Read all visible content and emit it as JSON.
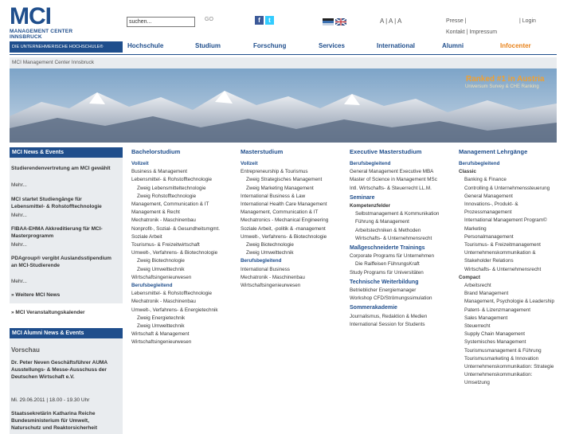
{
  "logo": {
    "mci": "MCI",
    "line1": "MANAGEMENT CENTER",
    "line2": "INNSBRUCK"
  },
  "tagline": "DIE UNTERNEHMERISCHE HOCHSCHULE®",
  "search": {
    "value": "suchen...",
    "go": "GO"
  },
  "font_size": "A | A | A",
  "top_links": {
    "presse": "Presse |",
    "login": "| Login",
    "kontakt": "Kontakt | Impressum"
  },
  "nav": [
    "Hochschule",
    "Studium",
    "Forschung",
    "Services",
    "International",
    "Alumni",
    "Infocenter"
  ],
  "breadcrumb": "MCI Management Center Innsbruck",
  "banner": {
    "ranked": "Ranked #1 in Austria",
    "survey": "Universum Survey & CHE Ranking"
  },
  "news": {
    "header": "MCI News & Events",
    "items": [
      {
        "title": "Studierendenvertretung am MCI gewählt",
        "more": "Mehr..."
      },
      {
        "title": "MCI startet Studiengänge für Lebensmittel- & Rohstofftechnologie",
        "more": "Mehr..."
      },
      {
        "title": "FIBAA-EHMA Akkreditierung für MCI-Masterprogramm",
        "more": "Mehr..."
      },
      {
        "title": "PDAgroup® vergibt Auslandsstipendium an MCI-Studierende",
        "more": "Mehr..."
      }
    ],
    "more_news": "» Weitere MCI News",
    "events": "» MCI Veranstaltungskalender"
  },
  "alumni": {
    "header": "MCI Alumni News & Events",
    "vorschau": "Vorschau",
    "item1": "Dr. Peter Neven Geschäftsführer AUMA Ausstellungs- & Messe-Ausschuss der Deutschen Wirtschaft e.V.",
    "date1": "Mi. 29.06.2011 | 18.00 - 19.30 Uhr",
    "item2": "Staatssekretärin Katharina Reiche Bundesministerium für Umwelt, Naturschutz und Reaktorsicherheit"
  },
  "bachelor": {
    "title": "Bachelorstudium",
    "s1": "Vollzeit",
    "list1": [
      [
        "Business & Management",
        0
      ],
      [
        "Lebensmittel- & Rohstofftechnologie",
        0
      ],
      [
        "Zweig Lebensmitteltechnologie",
        1
      ],
      [
        "Zweig Rohstofftechnologie",
        1
      ],
      [
        "Management, Communication & IT",
        0
      ],
      [
        "Management & Recht",
        0
      ],
      [
        "Mechatronik - Maschinenbau",
        0
      ],
      [
        "Nonprofit-, Sozial- & Gesundheitsmgmt.",
        0
      ],
      [
        "Soziale Arbeit",
        0
      ],
      [
        "Tourismus- & Freizeitwirtschaft",
        0
      ],
      [
        "Umwelt-, Verfahrens- & Biotechnologie",
        0
      ],
      [
        "Zweig Biotechnologie",
        1
      ],
      [
        "Zweig Umwelttechnik",
        1
      ],
      [
        "Wirtschaftsingenieurwesen",
        0
      ]
    ],
    "s2": "Berufsbegleitend",
    "list2": [
      [
        "Lebensmittel- & Rohstofftechnologie",
        0
      ],
      [
        "Mechatronik - Maschinenbau",
        0
      ],
      [
        "Umwelt-, Verfahrens- & Energietechnik",
        0
      ],
      [
        "Zweig Energietechnik",
        1
      ],
      [
        "Zweig Umwelttechnik",
        1
      ],
      [
        "Wirtschaft & Management",
        0
      ],
      [
        "Wirtschaftsingenieurwesen",
        0
      ]
    ]
  },
  "master": {
    "title": "Masterstudium",
    "s1": "Vollzeit",
    "list1": [
      [
        "Entrepreneurship & Tourismus",
        0
      ],
      [
        "Zweig Strategisches Management",
        1
      ],
      [
        "Zweig Marketing Management",
        1
      ],
      [
        "International Business & Law",
        0
      ],
      [
        "International Health Care Management",
        0
      ],
      [
        "Management, Communication & IT",
        0
      ],
      [
        "Mechatronics - Mechanical Engineering",
        0
      ],
      [
        "Soziale Arbeit, -politik & -management",
        0
      ],
      [
        "Umwelt-, Verfahrens- & Biotechnologie",
        0
      ],
      [
        "Zweig Biotechnologie",
        1
      ],
      [
        "Zweig Umwelttechnik",
        1
      ]
    ],
    "s2": "Berufsbegleitend",
    "list2": [
      [
        "International Business",
        0
      ],
      [
        "Mechatronik - Maschinenbau",
        0
      ],
      [
        "Wirtschaftsingenieurwesen",
        0
      ]
    ]
  },
  "exec": {
    "title": "Executive Masterstudium",
    "s1": "Berufsbegleitend",
    "list1": [
      "General Management Executive MBA",
      "Master of Science in Management MSc",
      "Intl. Wirtschafts- & Steuerrecht LL.M."
    ],
    "seminare": "Seminare",
    "s2": "Kompetenzfelder",
    "list2": [
      "Selbstmanagement & Kommunikation",
      "Führung & Management",
      "Arbeitstechniken & Methoden",
      "Wirtschafts- & Unternehmensrecht"
    ],
    "mass": "Maßgeschneiderte Trainings",
    "list3": [
      "Corporate Programs für Unternehmen",
      "Die Raiffeisen FührungsKraft",
      "Study Programs für Universitäten"
    ],
    "tech": "Technische Weiterbildung",
    "list4": [
      "Betrieblicher Energiemanager",
      "Workshop CFD/Strömungssimulation"
    ],
    "sommer": "Sommerakademie",
    "list5": [
      "Journalismus, Redaktion & Medien",
      "International Session for Students"
    ]
  },
  "lehrgang": {
    "title": "Management Lehrgänge",
    "s1": "Berufsbegleitend",
    "classic": "Classic",
    "list1": [
      "Banking & Finance",
      "Controlling & Unternehmenssteuerung",
      "General Management",
      "Innovations-, Produkt- &",
      "Prozessmanagement",
      "International Management Program©",
      "Marketing",
      "Personalmanagement",
      "Tourismus- & Freizeitmanagement",
      "Unternehmenskommunikation &",
      "Stakeholder Relations",
      "Wirtschafts- & Unternehmensrecht"
    ],
    "compact": "Compact",
    "list2": [
      "Arbeitsrecht",
      "Brand Management",
      "Management, Psychologie & Leadership",
      "Patent- & Lizenzmanagement",
      "Sales Management",
      "Steuerrecht",
      "Supply Chain Management",
      "Systemisches Management",
      "Tourismusmanagement & Führung",
      "Tourismusmarketing & Innovation",
      "Unternehmenskommunikation: Strategie",
      "Unternehmenskommunikation:",
      "Umsetzung"
    ]
  },
  "colors": {
    "brand": "#1f4e8c",
    "accent": "#e8821a",
    "panel": "#e9ecef"
  }
}
